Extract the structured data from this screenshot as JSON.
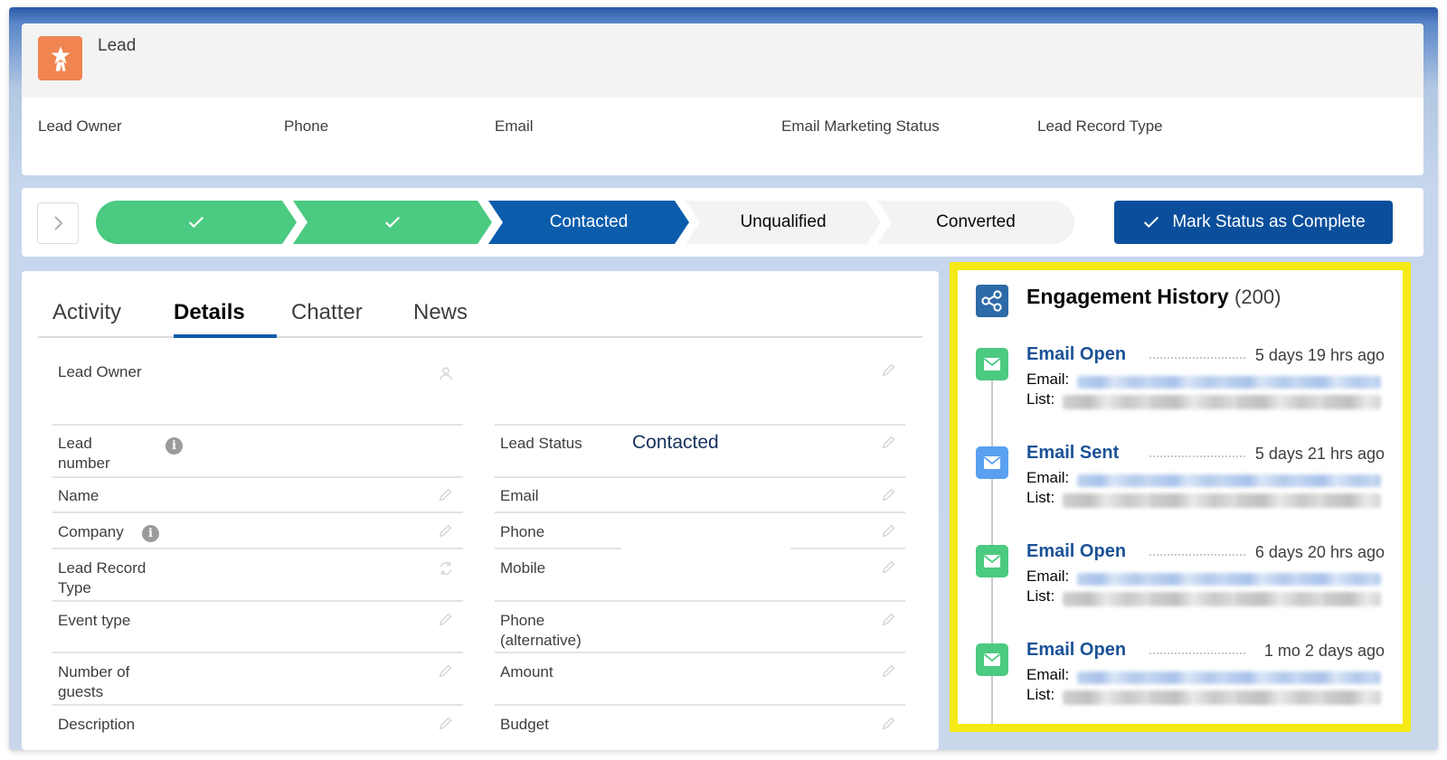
{
  "header": {
    "object_label": "Lead",
    "fields": [
      "Lead Owner",
      "Phone",
      "Email",
      "Email Marketing Status",
      "Lead Record Type"
    ]
  },
  "path": {
    "stages": [
      {
        "label": "",
        "state": "complete"
      },
      {
        "label": "",
        "state": "complete"
      },
      {
        "label": "Contacted",
        "state": "current"
      },
      {
        "label": "Unqualified",
        "state": "incomplete"
      },
      {
        "label": "Converted",
        "state": "incomplete"
      }
    ],
    "action_button": "Mark Status as Complete",
    "colors": {
      "complete": "#4bca81",
      "current": "#0b5cab",
      "incomplete": "#f3f3f3"
    }
  },
  "tabs": [
    "Activity",
    "Details",
    "Chatter",
    "News"
  ],
  "active_tab": "Details",
  "details": {
    "left": [
      {
        "label": "Lead Owner",
        "value": ""
      },
      {
        "label": "Lead number",
        "value": ""
      },
      {
        "label": "Name",
        "value": ""
      },
      {
        "label": "Company",
        "value": ""
      },
      {
        "label": "Lead Record Type",
        "value": ""
      },
      {
        "label": "Event type",
        "value": ""
      },
      {
        "label": "Number of guests",
        "value": ""
      },
      {
        "label": "Description",
        "value": ""
      }
    ],
    "right": [
      {
        "label": "Lead Status",
        "value": "Contacted"
      },
      {
        "label": "Email",
        "value": ""
      },
      {
        "label": "Phone",
        "value": ""
      },
      {
        "label": "Mobile",
        "value": ""
      },
      {
        "label": "Phone (alternative)",
        "value": ""
      },
      {
        "label": "Amount",
        "value": ""
      },
      {
        "label": "Budget",
        "value": ""
      }
    ]
  },
  "engagement": {
    "title": "Engagement History",
    "count": "(200)",
    "items": [
      {
        "type": "Email Open",
        "time": "5 days 19 hrs ago",
        "email_label": "Email:",
        "list_label": "List:",
        "icon": "envelope-icon",
        "color": "#4bca81"
      },
      {
        "type": "Email Sent",
        "time": "5 days 21 hrs ago",
        "email_label": "Email:",
        "list_label": "List:",
        "icon": "envelope-icon",
        "color": "#5aa0f0"
      },
      {
        "type": "Email Open",
        "time": "6 days 20 hrs ago",
        "email_label": "Email:",
        "list_label": "List:",
        "icon": "envelope-icon",
        "color": "#4bca81"
      },
      {
        "type": "Email Open",
        "time": "1 mo 2 days ago",
        "email_label": "Email:",
        "list_label": "List:",
        "icon": "envelope-icon",
        "color": "#4bca81"
      }
    ],
    "highlight_color": "#f5ea15"
  }
}
